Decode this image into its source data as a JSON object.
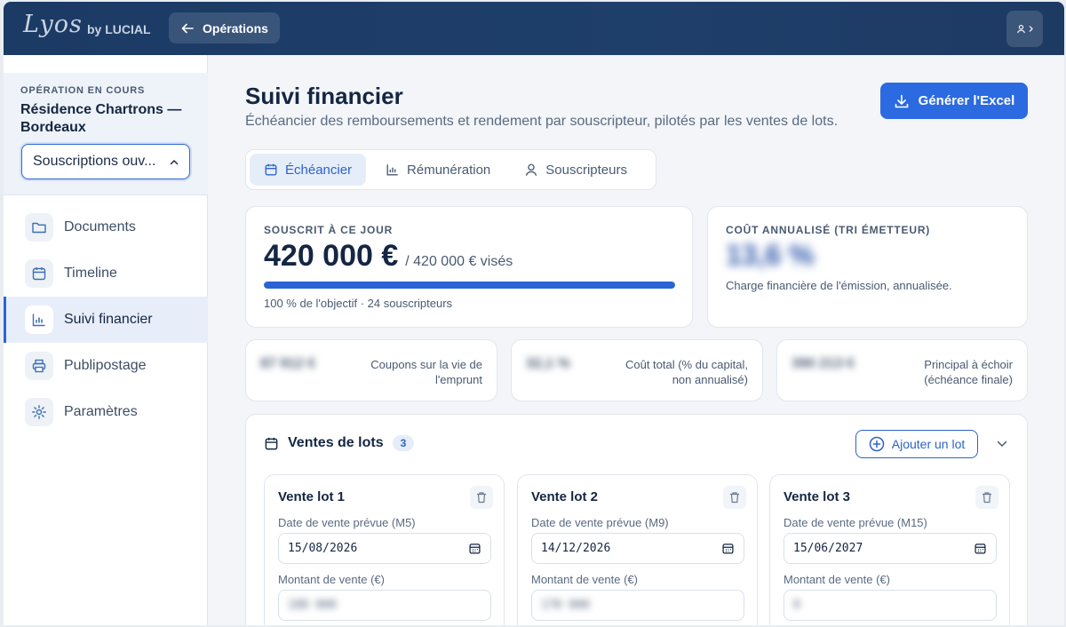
{
  "header": {
    "logo": "Lyos",
    "brand_suffix": "by LUCIAL",
    "back_label": "Opérations"
  },
  "sidebar": {
    "operation_label": "OPÉRATION EN COURS",
    "operation_name": "Résidence Chartrons — Bordeaux",
    "status_select": "Souscriptions ouv...",
    "items": [
      {
        "label": "Documents",
        "icon": "folder-icon"
      },
      {
        "label": "Timeline",
        "icon": "calendar-icon"
      },
      {
        "label": "Suivi financier",
        "icon": "chart-icon",
        "active": true
      },
      {
        "label": "Publipostage",
        "icon": "printer-icon"
      },
      {
        "label": "Paramètres",
        "icon": "gear-icon"
      }
    ]
  },
  "page": {
    "title": "Suivi financier",
    "subtitle": "Échéancier des remboursements et rendement par souscripteur, pilotés par les ventes de lots.",
    "excel_button": "Générer l'Excel"
  },
  "tabs": [
    {
      "label": "Échéancier",
      "active": true
    },
    {
      "label": "Rémunération"
    },
    {
      "label": "Souscripteurs"
    }
  ],
  "kpi_subscribed": {
    "label": "SOUSCRIT À CE JOUR",
    "value": "420 000 €",
    "target": "/ 420 000 € visés",
    "progress": 1.0,
    "caption": "100 % de l'objectif · 24 souscripteurs"
  },
  "kpi_cost": {
    "label": "COÛT ANNUALISÉ (TRI ÉMETTEUR)",
    "value": "13,6 %",
    "caption": "Charge financière de l'émission, annualisée."
  },
  "mini_kpis": [
    {
      "value": "87 912 €",
      "label": "Coupons sur la vie de l'emprunt"
    },
    {
      "value": "32,1 %",
      "label": "Coût total (% du capital, non annualisé)"
    },
    {
      "value": "390 213 €",
      "label": "Principal à échoir (échéance finale)"
    }
  ],
  "lots_section": {
    "title": "Ventes de lots",
    "count": "3",
    "add_button": "Ajouter un lot",
    "date_placeholder_label": "Date de vente prévue",
    "amount_label": "Montant de vente (€)",
    "lots": [
      {
        "title": "Vente lot 1",
        "date_label": "Date de vente prévue (M5)",
        "date": "15/08/2026",
        "amount_label": "Montant de vente (€)",
        "amount": "180 000"
      },
      {
        "title": "Vente lot 2",
        "date_label": "Date de vente prévue (M9)",
        "date": "14/12/2026",
        "amount_label": "Montant de vente (€)",
        "amount": "170 000"
      },
      {
        "title": "Vente lot 3",
        "date_label": "Date de vente prévue (M15)",
        "date": "15/06/2027",
        "amount_label": "Montant de vente (€)",
        "amount": "0"
      }
    ]
  }
}
